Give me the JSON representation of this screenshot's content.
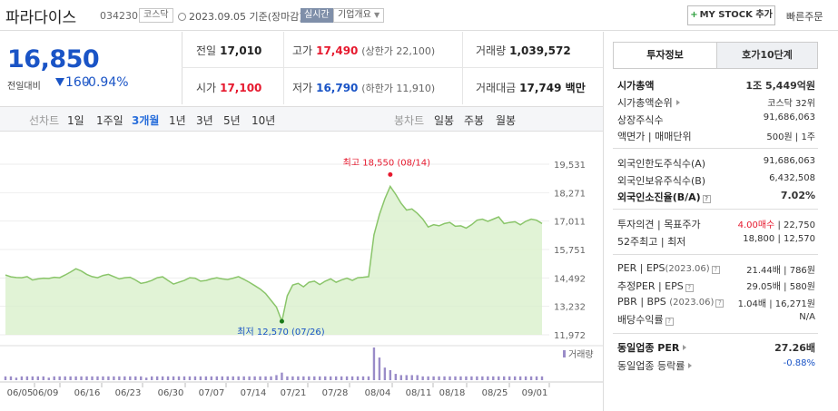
{
  "header": {
    "stock_name": "파라다이스",
    "stock_code": "034230",
    "market": "코스닥",
    "date_text": "2023.09.05 기준(장마감)",
    "live_label": "실시간",
    "company_info_label": "기업개요",
    "mystock_label": "MY STOCK 추가",
    "quick_order_label": "빠른주문"
  },
  "price": {
    "current": "16,850",
    "change_label": "전일대비",
    "change_value": "160",
    "change_pct": "-0.94%"
  },
  "quote": {
    "prev_label": "전일",
    "prev_value": "17,010",
    "high_label": "고가",
    "high_value": "17,490",
    "upper_limit": "(상한가 22,100)",
    "volume_label": "거래량",
    "volume_value": "1,039,572",
    "open_label": "시가",
    "open_value": "17,100",
    "low_label": "저가",
    "low_value": "16,790",
    "lower_limit": "(하한가 11,910)",
    "amount_label": "거래대금",
    "amount_value": "17,749 백만"
  },
  "period_tabs": {
    "line_label": "선차트",
    "items": [
      "1일",
      "1주일",
      "3개월",
      "1년",
      "3년",
      "5년",
      "10년"
    ],
    "active": "3개월",
    "candle_label": "봉차트",
    "candle_items": [
      "일봉",
      "주봉",
      "월봉"
    ]
  },
  "chart_data": {
    "type": "area",
    "y_ticks": [
      "19,531",
      "18,271",
      "17,011",
      "15,751",
      "14,492",
      "13,232",
      "11,972"
    ],
    "ylim": [
      11972,
      19531
    ],
    "x_ticks": [
      "06/05",
      "06/09",
      "06/16",
      "06/23",
      "06/30",
      "07/07",
      "07/14",
      "07/21",
      "07/28",
      "08/04",
      "08/11",
      "08/18",
      "08/25",
      "09/01"
    ],
    "max_label": "최고 18,550 (08/14)",
    "min_label": "최저 12,570 (07/26)",
    "volume_label": "거래량",
    "line_color": "#8ac56a",
    "fill_color": "#d9f0cc",
    "volume_color": "#9a8cc8",
    "series": [
      {
        "values": [
          14620,
          14540,
          14510,
          14500,
          14550,
          14400,
          14450,
          14480,
          14470,
          14520,
          14500,
          14620,
          14750,
          14900,
          14800,
          14650,
          14550,
          14500,
          14600,
          14650,
          14550,
          14450,
          14500,
          14520,
          14400,
          14250,
          14300,
          14380,
          14500,
          14540,
          14380,
          14220,
          14300,
          14380,
          14500,
          14480,
          14350,
          14380,
          14450,
          14500,
          14450,
          14420,
          14480,
          14550,
          14430,
          14300,
          14150,
          14000,
          13800,
          13500,
          13200,
          12570,
          13700,
          14180,
          14250,
          14100,
          14300,
          14350,
          14200,
          14350,
          14450,
          14300,
          14400,
          14480,
          14380,
          14500,
          14520,
          14550,
          16400,
          17300,
          18000,
          18550,
          18200,
          17800,
          17500,
          17550,
          17350,
          17100,
          16750,
          16850,
          16800,
          16900,
          16950,
          16780,
          16800,
          16700,
          16850,
          17050,
          17100,
          17000,
          17100,
          17200,
          16900,
          16950,
          16980,
          16850,
          17000,
          17100,
          17050,
          16900
        ]
      }
    ],
    "volume": [
      3,
      3,
      2,
      3,
      3,
      3,
      3,
      3,
      2,
      3,
      3,
      3,
      3,
      3,
      3,
      3,
      3,
      3,
      3,
      3,
      3,
      3,
      3,
      3,
      3,
      3,
      2,
      3,
      3,
      3,
      3,
      3,
      3,
      3,
      3,
      3,
      3,
      3,
      3,
      3,
      3,
      3,
      3,
      3,
      3,
      3,
      3,
      3,
      3,
      3,
      4,
      6,
      3,
      3,
      3,
      3,
      3,
      3,
      3,
      3,
      3,
      3,
      3,
      3,
      3,
      3,
      3,
      3,
      26,
      18,
      10,
      8,
      5,
      4,
      4,
      4,
      4,
      3,
      3,
      3,
      3,
      3,
      3,
      3,
      3,
      3,
      3,
      3,
      3,
      3,
      3,
      3,
      3,
      3,
      3,
      3,
      3,
      3,
      3,
      3
    ]
  },
  "right_panel": {
    "tab_info": "투자정보",
    "tab_ask": "호가10단계",
    "market_cap_label": "시가총액",
    "market_cap_value": "1조 5,449억원",
    "market_cap_rank_label": "시가총액순위",
    "market_cap_rank_value": "코스닥 32위",
    "shares_label": "상장주식수",
    "shares_value": "91,686,063",
    "par_label": "액면가",
    "par_sep": "매매단위",
    "par_value": "500원",
    "unit_value": "1주",
    "foreign_limit_label": "외국인한도주식수(A)",
    "foreign_limit_value": "91,686,063",
    "foreign_hold_label": "외국인보유주식수(B)",
    "foreign_hold_value": "6,432,508",
    "foreign_ratio_label": "외국인소진율(B/A)",
    "foreign_ratio_value": "7.02%",
    "opinion_label": "투자의견",
    "target_label": "목표주가",
    "opinion_value": "4.00매수",
    "target_value": "22,750",
    "w52_label": "52주최고",
    "w52_low_label": "최저",
    "w52_high_value": "18,800",
    "w52_low_value": "12,570",
    "per_label": "PER",
    "eps_label": "EPS",
    "per_period": "(2023.06)",
    "per_value": "21.44배",
    "eps_value": "786원",
    "est_per_label": "추정PER",
    "est_eps_label": "EPS",
    "est_per_value": "29.05배",
    "est_eps_value": "580원",
    "pbr_label": "PBR",
    "bps_label": "BPS",
    "pbr_period": "(2023.06)",
    "pbr_value": "1.04배",
    "bps_value": "16,271원",
    "div_label": "배당수익률",
    "div_value": "N/A",
    "sector_per_label": "동일업종 PER",
    "sector_per_value": "27.26배",
    "sector_rate_label": "동일업종 등락률",
    "sector_rate_value": "-0.88%"
  }
}
